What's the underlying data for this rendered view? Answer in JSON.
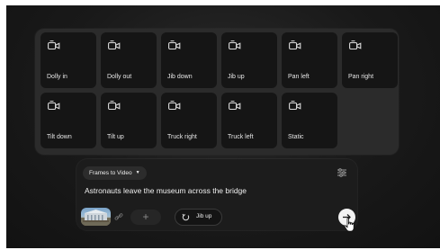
{
  "motion_panel": {
    "tiles": [
      {
        "label": "Dolly in",
        "icon": "dolly-camera-icon"
      },
      {
        "label": "Dolly out",
        "icon": "dolly-camera-icon"
      },
      {
        "label": "Jib down",
        "icon": "jib-camera-icon"
      },
      {
        "label": "Jib up",
        "icon": "jib-camera-icon"
      },
      {
        "label": "Pan left",
        "icon": "pan-camera-icon"
      },
      {
        "label": "Pan right",
        "icon": "pan-camera-icon"
      },
      {
        "label": "Tilt down",
        "icon": "tilt-camera-icon"
      },
      {
        "label": "Tilt up",
        "icon": "tilt-camera-icon"
      },
      {
        "label": "Truck right",
        "icon": "truck-camera-icon"
      },
      {
        "label": "Truck left",
        "icon": "truck-camera-icon"
      },
      {
        "label": "Static",
        "icon": "static-camera-icon"
      }
    ]
  },
  "prompt": {
    "mode_label": "Frames to Video",
    "text": "Astronauts leave the museum across the bridge",
    "add_label": "+",
    "selected_motion": "Jib up"
  },
  "colors": {
    "background": "#191919",
    "panel": "#2b2b2b",
    "tile": "#151515",
    "card": "#1c1c1c",
    "send": "#f2f2f2"
  },
  "icons": [
    "camera-motion-icon",
    "tune-icon",
    "link-icon",
    "motion-icon",
    "arrow-right-icon",
    "cursor-icon"
  ]
}
